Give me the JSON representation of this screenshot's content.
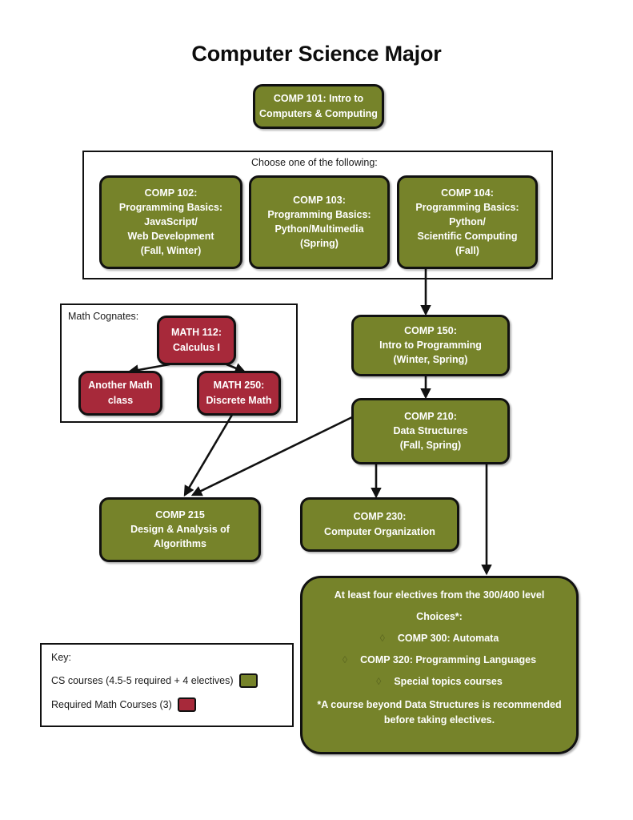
{
  "title": "Computer Science Major",
  "colors": {
    "cs_green": "#76832a",
    "math_red": "#a7293a",
    "outline": "#111111",
    "bullet": "#5c6720"
  },
  "nodes": {
    "comp101": {
      "lines": [
        "COMP 101: Intro to",
        "Computers & Computing"
      ]
    },
    "comp102": {
      "lines": [
        "COMP 102:",
        "Programming Basics:",
        "JavaScript/",
        "Web Development",
        "(Fall, Winter)"
      ]
    },
    "comp103": {
      "lines": [
        "COMP 103:",
        "Programming Basics:",
        "Python/Multimedia",
        "(Spring)"
      ]
    },
    "comp104": {
      "lines": [
        "COMP 104:",
        "Programming Basics:",
        "Python/",
        "Scientific Computing",
        "(Fall)"
      ]
    },
    "comp150": {
      "lines": [
        "COMP 150:",
        "Intro to Programming",
        "(Winter, Spring)"
      ]
    },
    "comp210": {
      "lines": [
        "COMP 210:",
        "Data Structures",
        "(Fall, Spring)"
      ]
    },
    "comp215": {
      "lines": [
        "COMP 215",
        "Design & Analysis of",
        "Algorithms"
      ]
    },
    "comp230": {
      "lines": [
        "COMP 230:",
        "Computer Organization"
      ]
    },
    "math112": {
      "lines": [
        "MATH 112:",
        "Calculus I"
      ]
    },
    "math_other": {
      "lines": [
        "Another Math",
        "class"
      ]
    },
    "math250": {
      "lines": [
        "MATH 250:",
        "Discrete Math"
      ]
    }
  },
  "groups": {
    "choose_one": {
      "label": "Choose one of the following:"
    },
    "math_cognates": {
      "label": "Math Cognates:"
    }
  },
  "electives": {
    "heading": "At least four electives from the 300/400 level",
    "choices_label": "Choices*:",
    "bullet_glyph": "◊",
    "choices": [
      "COMP 300: Automata",
      "COMP 320: Programming Languages",
      "Special topics courses"
    ],
    "note_line1": "*A course beyond Data Structures is recommended",
    "note_line2": "before taking electives."
  },
  "key": {
    "title": "Key:",
    "rows": [
      {
        "label": "CS courses (4.5-5 required + 4 electives)",
        "color": "#76832a"
      },
      {
        "label": "Required Math Courses (3)",
        "color": "#a7293a"
      }
    ]
  },
  "edges": [
    {
      "from": "comp104",
      "to": "comp150"
    },
    {
      "from": "comp150",
      "to": "comp210"
    },
    {
      "from": "comp210",
      "to": "comp215"
    },
    {
      "from": "comp210",
      "to": "comp230"
    },
    {
      "from": "comp210",
      "to": "electives"
    },
    {
      "from": "math112",
      "to": "math_other"
    },
    {
      "from": "math112",
      "to": "math250"
    },
    {
      "from": "math250",
      "to": "comp215"
    }
  ]
}
